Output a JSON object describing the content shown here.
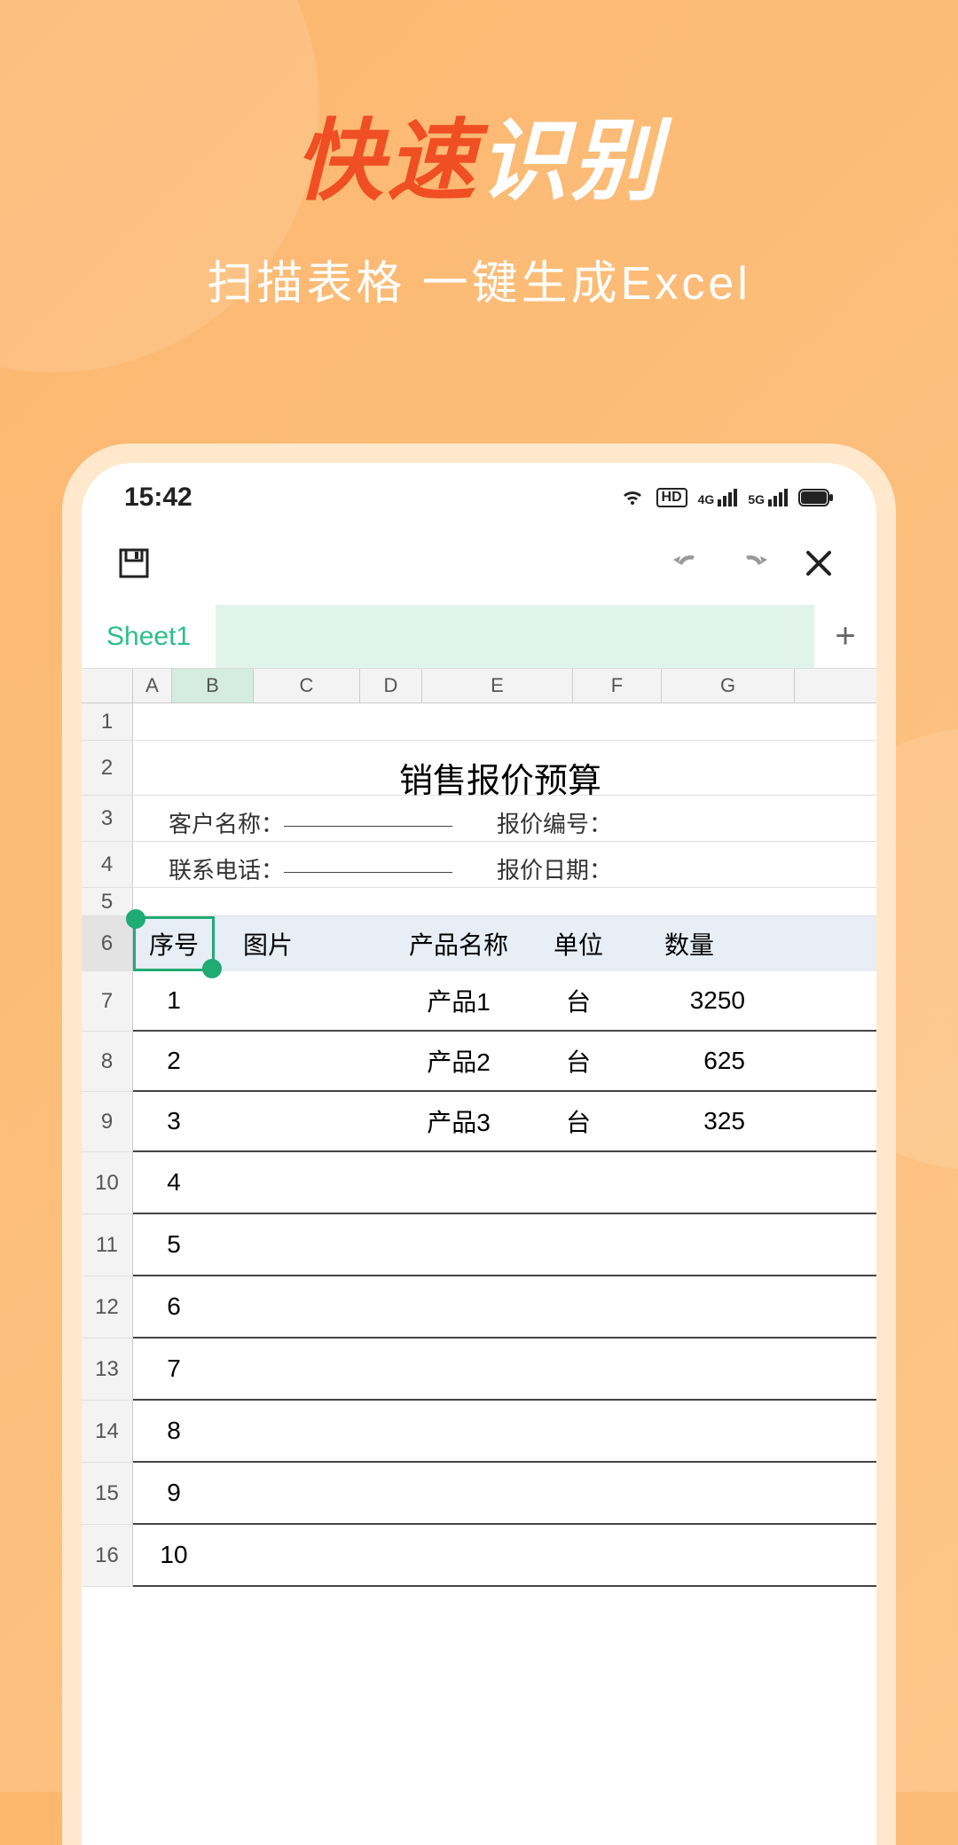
{
  "hero": {
    "fast": "快速",
    "recog": "识别",
    "sub": "扫描表格   一键生成Excel"
  },
  "statusbar": {
    "time": "15:42",
    "hd_label": "HD",
    "net1": "4G",
    "net2": "5G"
  },
  "sheet": {
    "tab_name": "Sheet1",
    "add_label": "+"
  },
  "columns": [
    "A",
    "B",
    "C",
    "D",
    "E",
    "F",
    "G"
  ],
  "rows": [
    "1",
    "2",
    "3",
    "4",
    "5",
    "6",
    "7",
    "8",
    "9",
    "10",
    "11",
    "12",
    "13",
    "14",
    "15",
    "16"
  ],
  "doc": {
    "title": "销售报价预算",
    "customer_name_label": "客户名称：",
    "quote_no_label": "报价编号：",
    "phone_label": "联系电话：",
    "quote_date_label": "报价日期："
  },
  "table_headers": {
    "seq": "序号",
    "pic": "图片",
    "name": "产品名称",
    "unit": "单位",
    "qty": "数量"
  },
  "chart_data": {
    "type": "table",
    "columns": [
      "序号",
      "图片",
      "产品名称",
      "单位",
      "数量"
    ],
    "rows": [
      {
        "seq": "1",
        "pic": "",
        "name": "产品1",
        "unit": "台",
        "qty": "3250"
      },
      {
        "seq": "2",
        "pic": "",
        "name": "产品2",
        "unit": "台",
        "qty": "625"
      },
      {
        "seq": "3",
        "pic": "",
        "name": "产品3",
        "unit": "台",
        "qty": "325"
      }
    ],
    "extra_seq": [
      "4",
      "5",
      "6",
      "7",
      "8",
      "9",
      "10"
    ]
  },
  "selection": {
    "cell": "B6"
  }
}
